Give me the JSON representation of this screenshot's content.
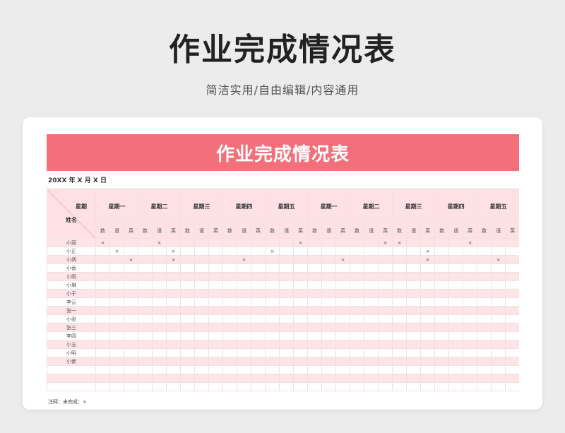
{
  "header": {
    "title": "作业完成情况表",
    "subtitle": "简洁实用/自由编辑/内容通用"
  },
  "sheet": {
    "banner_title": "作业完成情况表",
    "date_label": "20XX  年  X  月 X   日",
    "corner_top": "星期",
    "corner_bottom": "姓名",
    "days": [
      "星期一",
      "星期二",
      "星期三",
      "星期四",
      "星期五",
      "星期一",
      "星期二",
      "星期三",
      "星期四",
      "星期五"
    ],
    "subjects": [
      "数",
      "语",
      "英"
    ],
    "mark": "×",
    "rows": [
      {
        "name": "小丽",
        "marks": [
          [
            0,
            0
          ],
          [
            1,
            1
          ]
        ],
        "cells": [
          "×",
          "",
          "",
          "",
          "×",
          "",
          "",
          "",
          "",
          "",
          "",
          "",
          "",
          "",
          "×",
          "",
          "",
          "",
          "",
          "",
          "×",
          "×",
          "",
          "",
          "",
          "",
          "×",
          "",
          "",
          "",
          "",
          "×",
          ""
        ]
      },
      {
        "name": "小正",
        "cells": [
          "",
          "×",
          "",
          "",
          "",
          "×",
          "",
          "",
          "",
          "",
          "",
          "",
          "×",
          "",
          "",
          "",
          "",
          "",
          "",
          "",
          "",
          "",
          "",
          "×",
          "",
          "",
          "",
          "",
          "",
          "",
          "",
          "",
          ""
        ]
      },
      {
        "name": "小炳",
        "cells": [
          "",
          "",
          "×",
          "",
          "",
          "×",
          "",
          "",
          "",
          "",
          "×",
          "",
          "",
          "",
          "",
          "",
          "",
          "×",
          "",
          "",
          "",
          "",
          "",
          "×",
          "",
          "",
          "",
          "",
          "×",
          "",
          "",
          "",
          ""
        ]
      },
      {
        "name": "小香",
        "cells": []
      },
      {
        "name": "小雨",
        "cells": []
      },
      {
        "name": "小琳",
        "cells": []
      },
      {
        "name": "小于",
        "cells": []
      },
      {
        "name": "李云",
        "cells": []
      },
      {
        "name": "张一",
        "cells": []
      },
      {
        "name": "小张",
        "cells": []
      },
      {
        "name": "张三",
        "cells": []
      },
      {
        "name": "李四",
        "cells": []
      },
      {
        "name": "小五",
        "cells": []
      },
      {
        "name": "小明",
        "cells": []
      },
      {
        "name": "小紫",
        "cells": []
      },
      {
        "name": "",
        "cells": []
      },
      {
        "name": "",
        "cells": []
      },
      {
        "name": "",
        "cells": []
      }
    ],
    "note": "注释：未完成：×"
  },
  "colors": {
    "banner": "#f36f7a",
    "header_fill": "#fde1e4",
    "stripe": "#fde4e7"
  }
}
